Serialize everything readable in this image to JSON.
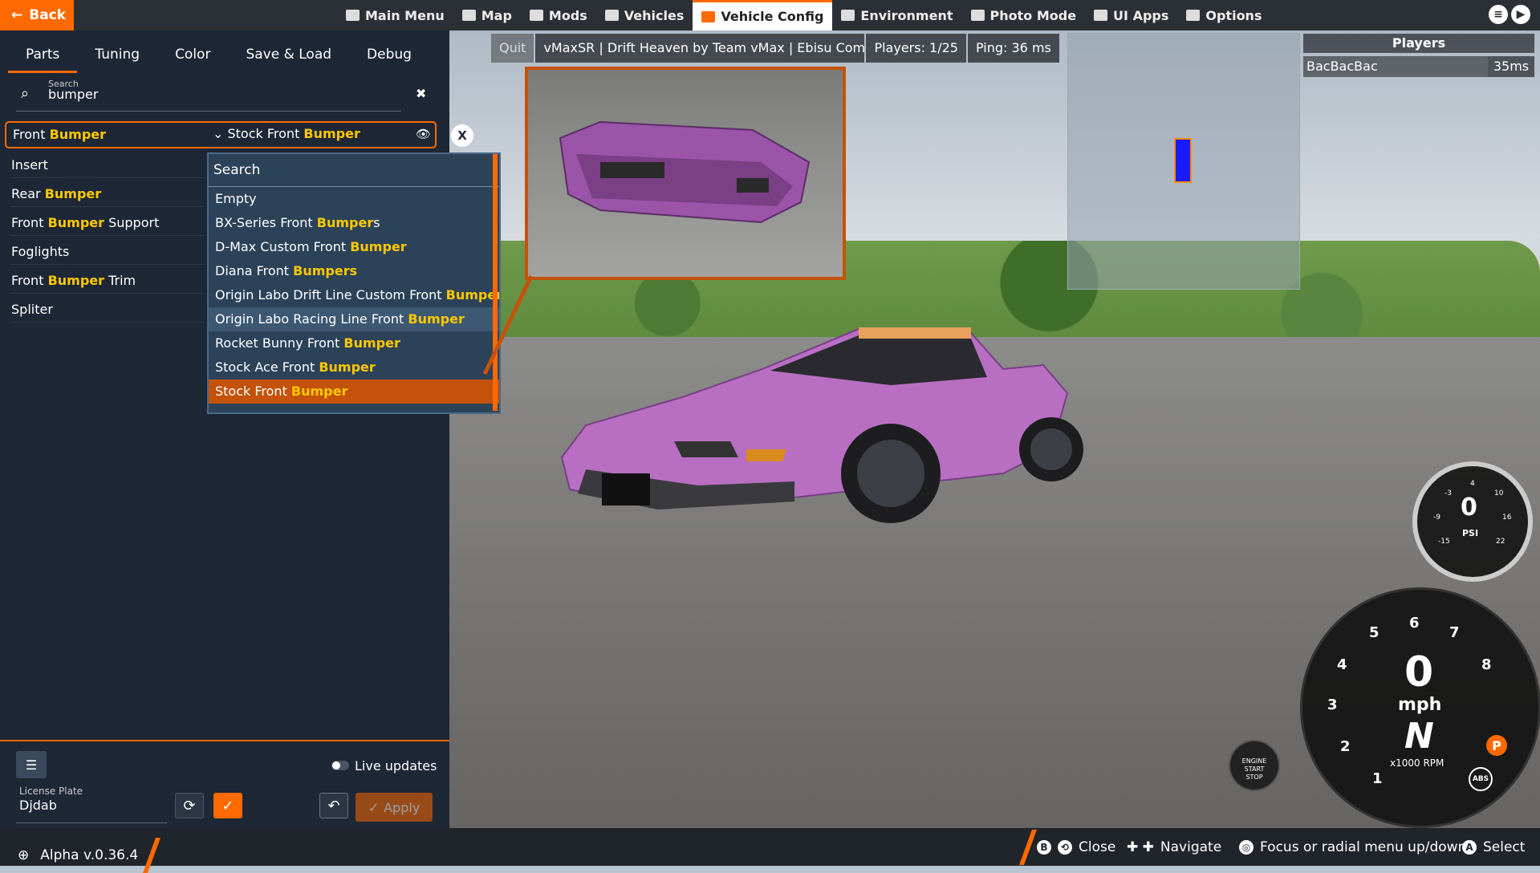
{
  "topbar": {
    "back_label": "Back",
    "nav": [
      "Main Menu",
      "Map",
      "Mods",
      "Vehicles",
      "Vehicle Config",
      "Environment",
      "Photo Mode",
      "UI Apps",
      "Options"
    ],
    "active_nav": "Vehicle Config"
  },
  "tabs": [
    "Parts",
    "Tuning",
    "Color",
    "Save & Load",
    "Debug"
  ],
  "search": {
    "label": "Search",
    "value": "bumper"
  },
  "selected_part": {
    "label_pre": "Front ",
    "label_hl": "Bumper",
    "value_pre": "Stock Front ",
    "value_hl": "Bumper"
  },
  "parts": [
    {
      "pre": "Insert",
      "hl": "",
      "post": ""
    },
    {
      "pre": "Rear ",
      "hl": "Bumper",
      "post": ""
    },
    {
      "pre": "Front ",
      "hl": "Bumper",
      "post": " Support"
    },
    {
      "pre": "Foglights",
      "hl": "",
      "post": ""
    },
    {
      "pre": "Front ",
      "hl": "Bumper",
      "post": " Trim"
    },
    {
      "pre": "Spliter",
      "hl": "",
      "post": ""
    }
  ],
  "dropdown": {
    "search_label": "Search",
    "items": [
      {
        "pre": "Empty",
        "hl": "",
        "post": ""
      },
      {
        "pre": "BX-Series Front ",
        "hl": "Bumper",
        "post": "s"
      },
      {
        "pre": "D-Max Custom Front ",
        "hl": "Bumper",
        "post": ""
      },
      {
        "pre": "Diana Front ",
        "hl": "Bumpers",
        "post": ""
      },
      {
        "pre": "Origin Labo Drift Line Custom Front ",
        "hl": "Bumper",
        "post": ""
      },
      {
        "pre": "Origin Labo Racing Line Front ",
        "hl": "Bumper",
        "post": ""
      },
      {
        "pre": "Rocket Bunny Front ",
        "hl": "Bumper",
        "post": ""
      },
      {
        "pre": "Stock Ace Front ",
        "hl": "Bumper",
        "post": ""
      },
      {
        "pre": "Stock Front ",
        "hl": "Bumper",
        "post": ""
      }
    ]
  },
  "bottom": {
    "live_updates": "Live updates",
    "license_label": "License Plate",
    "license_value": "Djdab",
    "apply": "Apply"
  },
  "infobar": {
    "quit": "Quit",
    "title": "vMaxSR | Drift Heaven by Team vMax | Ebisu Comple",
    "players": "Players: 1/25",
    "ping": "Ping: 36 ms"
  },
  "players_panel": {
    "title": "Players",
    "name": "BacBacBac",
    "ping": "35ms"
  },
  "gauges": {
    "boost_value": "0",
    "boost_unit": "PSI",
    "boost_ticks": [
      "-3",
      "4",
      "10",
      "-9",
      "16",
      "-15",
      "22"
    ],
    "speed": "0",
    "speed_unit": "mph",
    "gear": "N",
    "rpm_label": "x1000 RPM",
    "rpm_ticks": [
      "1",
      "2",
      "3",
      "4",
      "5",
      "6",
      "7",
      "8"
    ],
    "engine_label_1": "ENGINE",
    "engine_label_2": "START",
    "engine_label_3": "STOP",
    "abs": "ABS",
    "parking": "P"
  },
  "footer": {
    "version": "Alpha v.0.36.4",
    "close": "Close",
    "navigate": "Navigate",
    "focus": "Focus or radial menu up/down",
    "select": "Select",
    "b_key": "B",
    "a_key": "A"
  },
  "colors": {
    "accent": "#ff6a00",
    "highlight": "#ffc900",
    "panel": "#1d2735",
    "dropdown": "#2c4258",
    "car": "#b86fc2"
  }
}
